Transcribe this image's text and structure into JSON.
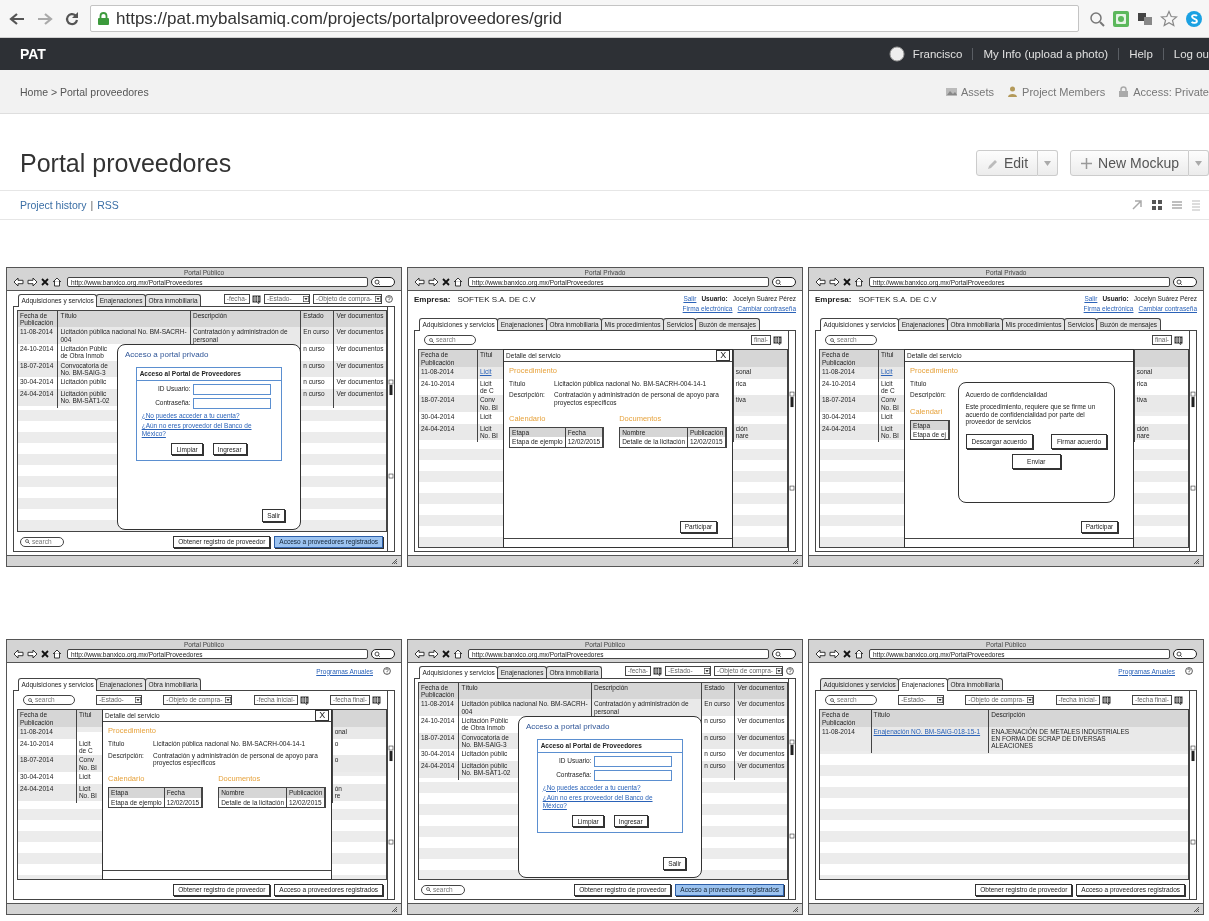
{
  "browser": {
    "url": "https://pat.mybalsamiq.com/projects/portalproveedores/grid"
  },
  "app_bar": {
    "title": "PAT",
    "user": "Francisco",
    "links": [
      "My Info (upload a photo)",
      "Help",
      "Log ou"
    ]
  },
  "breadcrumb": "Home > Portal proveedores",
  "project_links": [
    {
      "kind": "assets",
      "label": "Assets"
    },
    {
      "kind": "members",
      "label": "Project Members"
    },
    {
      "kind": "access",
      "label": "Access: Private"
    }
  ],
  "page_title": "Portal proveedores",
  "actions": [
    {
      "kind": "edit",
      "label": "Edit"
    },
    {
      "kind": "new",
      "label": "New Mockup"
    }
  ],
  "history_links": {
    "items": [
      "Project history",
      "RSS"
    ],
    "separator": "|"
  },
  "mockups": [
    {
      "title": "Portal Público",
      "url": "http://www.banxico.org.mx/PortalProveedores",
      "tabs": [
        {
          "label": "Adquisiciones y servicios",
          "selected": true
        },
        {
          "label": "Enajenaciones",
          "selected": false
        },
        {
          "label": "Obra inmobiliaria",
          "selected": false
        }
      ],
      "filters": [
        {
          "kind": "field",
          "text": "-fecha-"
        },
        {
          "kind": "calendar"
        },
        {
          "kind": "dropdown",
          "text": "-Estado-"
        },
        {
          "kind": "dropdown",
          "text": "-Objeto de compra-"
        },
        {
          "kind": "help"
        }
      ],
      "table": {
        "columns": [
          {
            "label": "Fecha de\nPublicación"
          },
          {
            "label": "Título"
          },
          {
            "label": "Descripción"
          },
          {
            "label": "Estado"
          },
          {
            "label": "Ver documentos"
          }
        ],
        "rows": [
          [
            "11-08-2014",
            "Licitación pública nacional No. BM-SACRH-004",
            "Contratación y administración de personal",
            "En curso",
            "Ver documentos"
          ],
          [
            "24-10-2014",
            "Licitación Públic\nde Obra Inmob",
            null,
            "n curso",
            "Ver documentos"
          ],
          [
            "18-07-2014",
            "Convocatoria de\nNo. BM-SAIG-3",
            null,
            "n curso",
            "Ver documentos"
          ],
          [
            "30-04-2014",
            "Licitación públic",
            null,
            "n curso",
            "Ver documentos"
          ],
          [
            "24-04-2014",
            "Licitación públic\nNo. BM-SAT1-02",
            null,
            "n curso",
            "Ver documentos"
          ]
        ]
      },
      "footer": [
        {
          "kind": "search",
          "text": "search"
        },
        {
          "kind": "button",
          "text": "Obtener registro de proveedor",
          "selected": false
        },
        {
          "kind": "button",
          "text": "Acceso a proveedores registrados",
          "selected": true
        }
      ],
      "dialog": {
        "kind": "login",
        "title": "Acceso a portal privado",
        "form_title": "Acceso al Portal de Proveedores",
        "fields": [
          "ID Usuario:",
          "Contraseña:"
        ],
        "links": [
          "¿No puedes acceder a tu cuenta?",
          "¿Aún no eres proveedor del Banco de México?"
        ],
        "buttons": [
          "Limpiar",
          "Ingresar"
        ],
        "exit": "Salir"
      }
    },
    {
      "title": "Portal Privado",
      "url": "http://www.banxico.org.mx/PortalProveedores",
      "header": {
        "kind": "private",
        "company_label": "Empresa:",
        "company": "SOFTEK S.A. DE C.V",
        "logout": "Salir",
        "user_label": "Usuario:",
        "user": "Jocelyn Suárez Pérez",
        "links": [
          "Firma electrónica",
          "Cambiar contraseña"
        ]
      },
      "tabs": [
        {
          "label": "Adquisiciones y servicios",
          "selected": true
        },
        {
          "label": "Enajenaciones",
          "selected": false
        },
        {
          "label": "Obra inmobiliaria",
          "selected": false
        },
        {
          "label": "Mis procedimientos",
          "selected": false
        },
        {
          "label": "Servicios",
          "selected": false
        },
        {
          "label": "Buzón de mensajes",
          "selected": false
        }
      ],
      "filters": [
        {
          "kind": "search",
          "text": "search"
        },
        {
          "kind": "field",
          "text": "final-"
        },
        {
          "kind": "calendar"
        }
      ],
      "table": {
        "columns": [
          {
            "label": "Fecha de\nPublicación"
          },
          {
            "label": "Títul"
          },
          {},
          {}
        ],
        "rows": [
          [
            "11-08-2014",
            {
              "text": "Licit",
              "link": true
            },
            null,
            "sonal"
          ],
          [
            "24-10-2014",
            "Licit\nde C",
            null,
            "rica"
          ],
          [
            "18-07-2014",
            "Conv\nNo. Bl",
            null,
            "tiva"
          ],
          [
            "30-04-2014",
            "Licit",
            null,
            null
          ],
          [
            "24-04-2014",
            "Licit\nNo. Bl",
            null,
            "ción\nnare"
          ]
        ]
      },
      "dialog": {
        "kind": "detail",
        "title": "Detalle del servicio",
        "close": "X",
        "section": "Procedimiento",
        "fields": [
          {
            "label": "Título",
            "value": "Licitación pública nacional No. BM-SACRH-004-14-1"
          },
          {
            "label": "Descripción:",
            "value": "Contratación y administración de personal de apoyo para proyectos específicos"
          }
        ],
        "calendar": {
          "heading": "Calendario",
          "columns": [
            "Etapa",
            "Fecha"
          ],
          "rows": [
            [
              "Etapa de ejemplo",
              "12/02/2015"
            ]
          ]
        },
        "documents": {
          "heading": "Documentos",
          "columns": [
            "Nombre",
            "Publicación"
          ],
          "rows": [
            [
              "Detalle de la licitación",
              "12/02/2015"
            ]
          ]
        },
        "button": "Participar"
      }
    },
    {
      "title": "Portal Privado",
      "url": "http://www.banxico.org.mx/PortalProveedores",
      "header": {
        "kind": "private",
        "company_label": "Empresa:",
        "company": "SOFTEK S.A. DE C.V",
        "logout": "Salir",
        "user_label": "Usuario:",
        "user": "Jocelyn Suárez Pérez",
        "links": [
          "Firma electrónica",
          "Cambiar contraseña"
        ]
      },
      "tabs": [
        {
          "label": "Adquisiciones y servicios",
          "selected": true
        },
        {
          "label": "Enajenaciones",
          "selected": false
        },
        {
          "label": "Obra inmobiliaria",
          "selected": false
        },
        {
          "label": "Mis procedimientos",
          "selected": false
        },
        {
          "label": "Servicios",
          "selected": false
        },
        {
          "label": "Buzón de mensajes",
          "selected": false
        }
      ],
      "filters": [
        {
          "kind": "search",
          "text": "search"
        },
        {
          "kind": "field",
          "text": "final-"
        },
        {
          "kind": "calendar"
        }
      ],
      "table": {
        "columns": [
          {
            "label": "Fecha de\nPublicación"
          },
          {
            "label": "Títul"
          },
          {},
          {}
        ],
        "rows": [
          [
            "11-08-2014",
            {
              "text": "Licit",
              "link": true
            },
            null,
            "sonal"
          ],
          [
            "24-10-2014",
            "Licit\nde C",
            null,
            "rica"
          ],
          [
            "18-07-2014",
            "Conv\nNo. Bl",
            null,
            "tiva"
          ],
          [
            "30-04-2014",
            "Licit",
            null,
            null
          ],
          [
            "24-04-2014",
            "Licit\nNo. Bl",
            null,
            "ción\nnare"
          ]
        ]
      },
      "dialog": {
        "kind": "detail",
        "title": "Detalle del servicio",
        "section": "Procedimiento",
        "fields": [
          {
            "label": "Título"
          },
          {
            "label": "Descripción:"
          }
        ],
        "calendar": {
          "heading": "Calendari",
          "columns": [
            "Etapa"
          ],
          "rows": [
            [
              "Etapa de ej"
            ]
          ]
        },
        "button": "Participar",
        "confirm": {
          "title": "Acuerdo de confidencialidad",
          "text": "Este procedimiento, requiere que se firme un acuerdo de confidencialidad por parte del proveedor de servicios",
          "buttons": [
            "Descargar acuerdo",
            "Firmar acuerdo"
          ],
          "submit": "Enviar"
        }
      }
    },
    {
      "title": "Portal Público",
      "url": "http://www.banxico.org.mx/PortalProveedores",
      "header": {
        "kind": "links",
        "link": "Programas Anuales"
      },
      "tabs": [
        {
          "label": "Adquisiciones y servicios",
          "selected": true
        },
        {
          "label": "Enajenaciones",
          "selected": false
        },
        {
          "label": "Obra inmobiliaria",
          "selected": false
        }
      ],
      "filters": [
        {
          "kind": "search",
          "text": "search"
        },
        {
          "kind": "dropdown",
          "text": "-Estado-"
        },
        {
          "kind": "dropdown",
          "text": "-Objeto de compra-"
        },
        {
          "kind": "field",
          "text": "-fecha inicial-"
        },
        {
          "kind": "calendar"
        },
        {
          "kind": "field",
          "text": "-fecha final-"
        },
        {
          "kind": "calendar"
        }
      ],
      "table": {
        "columns": [
          {
            "label": "Fecha de\nPublicación"
          },
          {
            "label": "Títul"
          },
          {},
          {}
        ],
        "rows": [
          [
            "11-08-2014",
            null,
            null,
            "onal"
          ],
          [
            "24-10-2014",
            "Licit\nde C",
            null,
            "o"
          ],
          [
            "18-07-2014",
            "Conv\nNo. Bl",
            null,
            "o"
          ],
          [
            "30-04-2014",
            "Licit",
            null,
            null
          ],
          [
            "24-04-2014",
            "Licit\nNo. Bl",
            null,
            "ón\nre"
          ]
        ]
      },
      "footer": [
        {
          "kind": "button",
          "text": "Obtener registro de proveedor",
          "selected": false
        },
        {
          "kind": "button",
          "text": "Acceso a proveedores registrados",
          "selected": false
        }
      ],
      "dialog": {
        "kind": "detail",
        "title": "Detalle del servicio",
        "close": "X",
        "section": "Procedimiento",
        "fields": [
          {
            "label": "Título",
            "value": "Licitación pública nacional No. BM-SACRH-004-14-1"
          },
          {
            "label": "Descripción:",
            "value": "Contratación y administración de personal de apoyo para proyectos específicos"
          }
        ],
        "calendar": {
          "heading": "Calendario",
          "columns": [
            "Etapa",
            "Fecha"
          ],
          "rows": [
            [
              "Etapa de ejemplo",
              "12/02/2015"
            ]
          ]
        },
        "documents": {
          "heading": "Documentos",
          "columns": [
            "Nombre",
            "Publicación"
          ],
          "rows": [
            [
              "Detalle de la licitación",
              "12/02/2015"
            ]
          ]
        }
      }
    },
    {
      "title": "Portal Público",
      "url": "http://www.banxico.org.mx/PortalProveedores",
      "tabs": [
        {
          "label": "Adquisiciones y servicios",
          "selected": true
        },
        {
          "label": "Enajenaciones",
          "selected": false
        },
        {
          "label": "Obra inmobiliaria",
          "selected": false
        }
      ],
      "filters": [
        {
          "kind": "field",
          "text": "-fecha-"
        },
        {
          "kind": "calendar"
        },
        {
          "kind": "dropdown",
          "text": "-Estado-"
        },
        {
          "kind": "dropdown",
          "text": "-Objeto de compra-"
        },
        {
          "kind": "help"
        }
      ],
      "table": {
        "columns": [
          {
            "label": "Fecha de\nPublicación"
          },
          {
            "label": "Título"
          },
          {
            "label": "Descripción"
          },
          {
            "label": "Estado"
          },
          {
            "label": "Ver documentos"
          }
        ],
        "rows": [
          [
            "11-08-2014",
            "Licitación pública nacional No. BM-SACRH-004",
            "Contratación y administración de personal",
            "En curso",
            "Ver documentos"
          ],
          [
            "24-10-2014",
            "Licitación Públic\nde Obra Inmob",
            null,
            "n curso",
            "Ver documentos"
          ],
          [
            "18-07-2014",
            "Convocatoria de\nNo. BM-SAIG-3",
            null,
            "n curso",
            "Ver documentos"
          ],
          [
            "30-04-2014",
            "Licitación públic",
            null,
            "n curso",
            "Ver documentos"
          ],
          [
            "24-04-2014",
            "Licitación públic\nNo. BM-SAT1-02",
            null,
            "n curso",
            "Ver documentos"
          ]
        ]
      },
      "footer": [
        {
          "kind": "search",
          "text": "search"
        },
        {
          "kind": "button",
          "text": "Obtener registro de proveedor",
          "selected": false
        },
        {
          "kind": "button",
          "text": "Acceso a proveedores registrados",
          "selected": true
        }
      ],
      "dialog": {
        "kind": "login",
        "title": "Acceso a portal privado",
        "form_title": "Acceso al Portal de Proveedores",
        "fields": [
          "ID Usuario:",
          "Contraseña:"
        ],
        "links": [
          "¿No puedes acceder a tu cuenta?",
          "¿Aún no eres proveedor del Banco de México?"
        ],
        "buttons": [
          "Limpiar",
          "Ingresar"
        ],
        "exit": "Salir"
      }
    },
    {
      "title": "Portal Público",
      "url": "http://www.banxico.org.mx/PortalProveedores",
      "header": {
        "kind": "links",
        "link": "Programas Anuales"
      },
      "tabs": [
        {
          "label": "Adquisiciones y servicios",
          "selected": false
        },
        {
          "label": "Enajenaciones",
          "selected": true
        },
        {
          "label": "Obra inmobiliaria",
          "selected": false
        }
      ],
      "filters": [
        {
          "kind": "search",
          "text": "search"
        },
        {
          "kind": "dropdown",
          "text": "-Estado-"
        },
        {
          "kind": "dropdown",
          "text": "-Objeto de compra-"
        },
        {
          "kind": "field",
          "text": "-fecha inicial-"
        },
        {
          "kind": "calendar"
        },
        {
          "kind": "field",
          "text": "-fecha final-"
        },
        {
          "kind": "calendar"
        }
      ],
      "table": {
        "columns": [
          {
            "label": "Fecha de\nPublicación"
          },
          {
            "label": "Título"
          },
          {
            "label": "Descripción"
          }
        ],
        "rows": [
          [
            "11-08-2014",
            {
              "text": "Enajenación NO. BM-SAIG-018-15-1",
              "link": true
            },
            "ENAJENACIÓN DE METALES INDUSTRIALES\nEN FORMA DE SCRAP DE DIVERSAS\nALEACIONES"
          ]
        ]
      },
      "footer": [
        {
          "kind": "button",
          "text": "Obtener registro de proveedor",
          "selected": false
        },
        {
          "kind": "button",
          "text": "Acceso a proveedores registrados",
          "selected": false
        }
      ]
    }
  ]
}
